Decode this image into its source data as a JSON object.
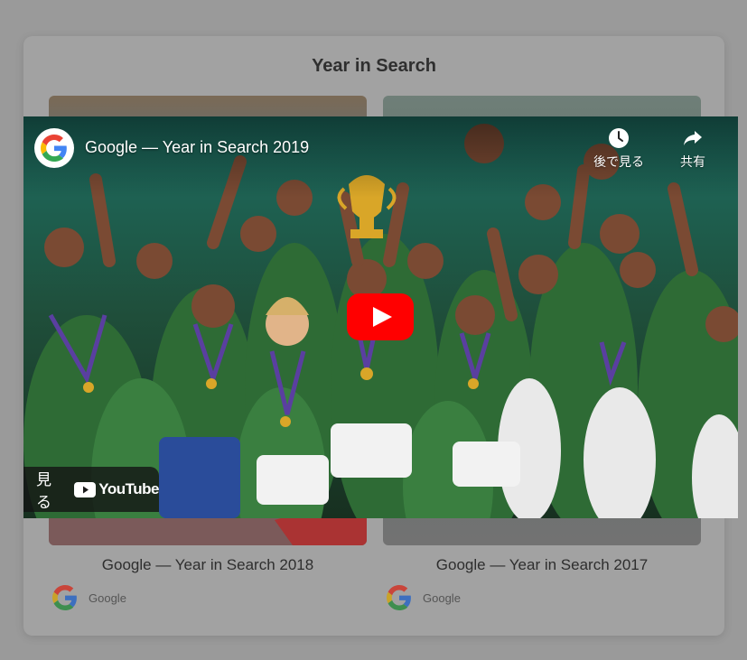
{
  "page": {
    "section_title": "Year in Search",
    "cards": [
      {
        "title": "Google — Year in Search 2018",
        "source": "Google"
      },
      {
        "title": "Google — Year in Search 2017",
        "source": "Google"
      }
    ]
  },
  "player": {
    "video_title": "Google — Year in Search 2019",
    "channel_icon": "google-g-logo",
    "watch_later_label": "後で見る",
    "share_label": "共有",
    "watch_on_label": "見る",
    "brand_label": "YouTube",
    "colors": {
      "play_red": "#ff0000",
      "jersey_green": "#2e6b35",
      "trophy_gold": "#d9a628"
    }
  }
}
